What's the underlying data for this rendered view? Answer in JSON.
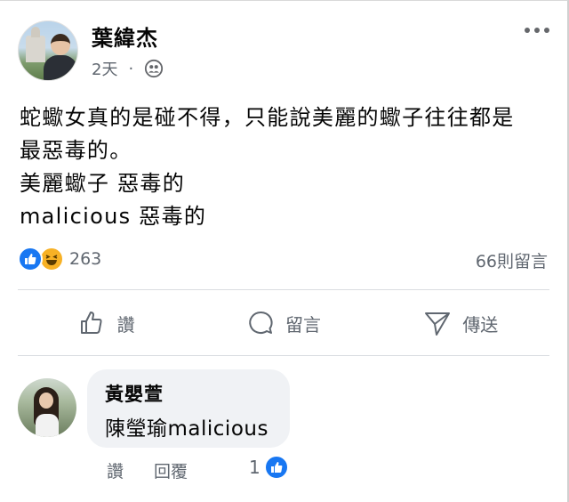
{
  "post": {
    "author": "葉緯杰",
    "time": "2天",
    "separator": "·",
    "privacy_icon": "friends-icon",
    "text_lines": [
      "蛇蠍女真的是碰不得，只能說美麗的蠍子往往都是",
      "最惡毒的。",
      "美麗蠍子 惡毒的",
      "malicious 惡毒的"
    ],
    "reactions": {
      "icons": [
        "like-icon",
        "haha-icon"
      ],
      "count": "263"
    },
    "comment_count": "66則留言"
  },
  "actions": {
    "like": "讚",
    "comment": "留言",
    "share": "傳送"
  },
  "comment": {
    "author": "黃嬰萱",
    "text": "陳瑩瑜malicious",
    "like_label": "讚",
    "reply_label": "回覆",
    "like_count": "1"
  },
  "colors": {
    "accent": "#1877f2",
    "haha": "#f7b125",
    "secondary_text": "#606770",
    "bubble": "#f0f2f5"
  }
}
